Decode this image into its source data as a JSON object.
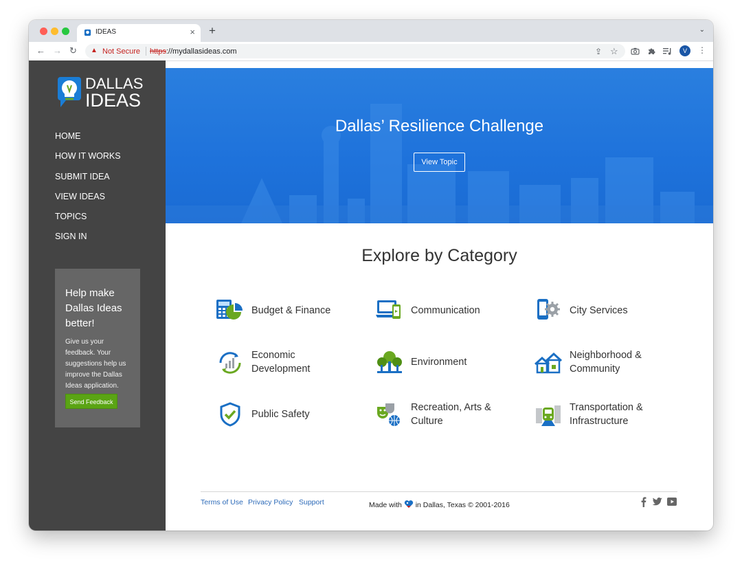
{
  "browser": {
    "tab_title": "IDEAS",
    "new_tab_glyph": "+",
    "security_label": "Not Secure",
    "url_scheme": "https",
    "url_rest": "://mydallasideas.com",
    "profile_initial": "V"
  },
  "sidebar": {
    "logo_line1": "DALLAS",
    "logo_line2": "IDEAS",
    "nav": [
      "HOME",
      "HOW IT WORKS",
      "SUBMIT IDEA",
      "VIEW IDEAS",
      "TOPICS",
      "SIGN IN"
    ],
    "help_title": "Help make Dallas Ideas better!",
    "help_text": "Give us your feedback. Your suggestions help us improve the Dallas Ideas application.",
    "feedback_button": "Send Feedback"
  },
  "hero": {
    "title": "Dallas’ Resilience Challenge",
    "button": "View Topic"
  },
  "categories_title": "Explore by Category",
  "categories": [
    {
      "line1": "Budget & Finance",
      "line2": "",
      "icon": "calculator-pie-icon"
    },
    {
      "line1": "Communication",
      "line2": "",
      "icon": "laptop-phone-icon"
    },
    {
      "line1": "City Services",
      "line2": "",
      "icon": "phone-gear-icon"
    },
    {
      "line1": "Economic",
      "line2": "Development",
      "icon": "growth-chart-icon"
    },
    {
      "line1": "Environment",
      "line2": "",
      "icon": "trees-icon"
    },
    {
      "line1": "Neighborhood &",
      "line2": "Community",
      "icon": "houses-icon"
    },
    {
      "line1": "Public Safety",
      "line2": "",
      "icon": "shield-check-icon"
    },
    {
      "line1": "Recreation, Arts &",
      "line2": "Culture",
      "icon": "masks-ball-icon"
    },
    {
      "line1": "Transportation &",
      "line2": "Infrastructure",
      "icon": "train-city-icon"
    }
  ],
  "footer": {
    "links": [
      "Terms of Use",
      "Privacy Policy",
      "Support"
    ],
    "made_prefix": "Made with",
    "made_suffix": "in Dallas, Texas © 2001-2016",
    "social": [
      "facebook-icon",
      "twitter-icon",
      "youtube-icon"
    ]
  },
  "colors": {
    "sidebar": "#444444",
    "hero_blue": "#1e72db",
    "link_blue": "#2c6ab8",
    "feedback_green": "#5aa414",
    "icon_blue": "#1a6fc4",
    "icon_green": "#6aa820"
  }
}
